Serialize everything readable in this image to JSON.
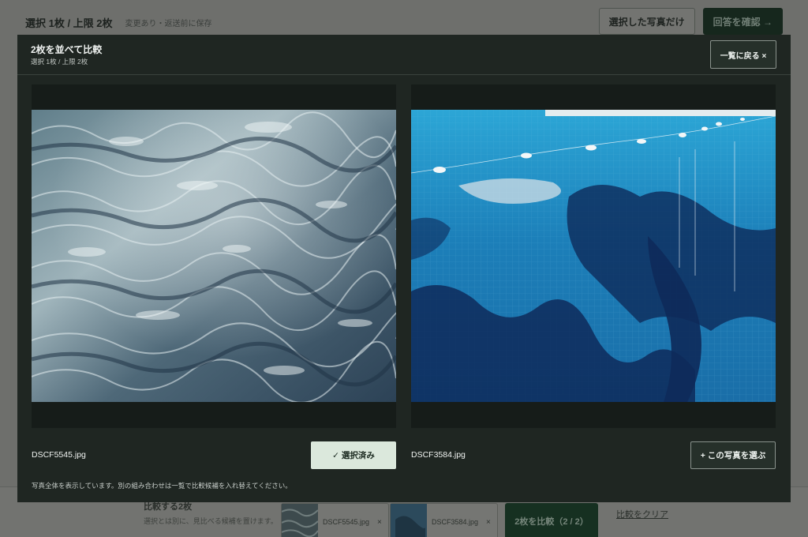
{
  "background": {
    "header": {
      "title": "選択 1枚 / 上限 2枚",
      "subtitle": "変更あり・返送前に保存",
      "selected_only_label": "選択した写真だけ",
      "confirm_label": "回答を確認 →"
    },
    "footer": {
      "heading": "比較する2枚",
      "note": "選択とは別に、見比べる候補を置けます。",
      "chips": [
        {
          "name": "DSCF5545.jpg",
          "remove": "×"
        },
        {
          "name": "DSCF3584.jpg",
          "remove": "×"
        }
      ],
      "compare_label": "2枚を比較（2 / 2）",
      "clear_label": "比較をクリア"
    }
  },
  "modal": {
    "title": "2枚を並べて比較",
    "subtitle": "選択 1枚 / 上限 2枚",
    "close_label": "一覧に戻る ×",
    "note": "写真全体を表示しています。別の組み合わせは一覧で比較候補を入れ替えてください。",
    "left": {
      "filename": "DSCF5545.jpg",
      "button_label": "✓ 選択済み"
    },
    "right": {
      "filename": "DSCF3584.jpg",
      "button_label": "+ この写真を選ぶ"
    }
  }
}
